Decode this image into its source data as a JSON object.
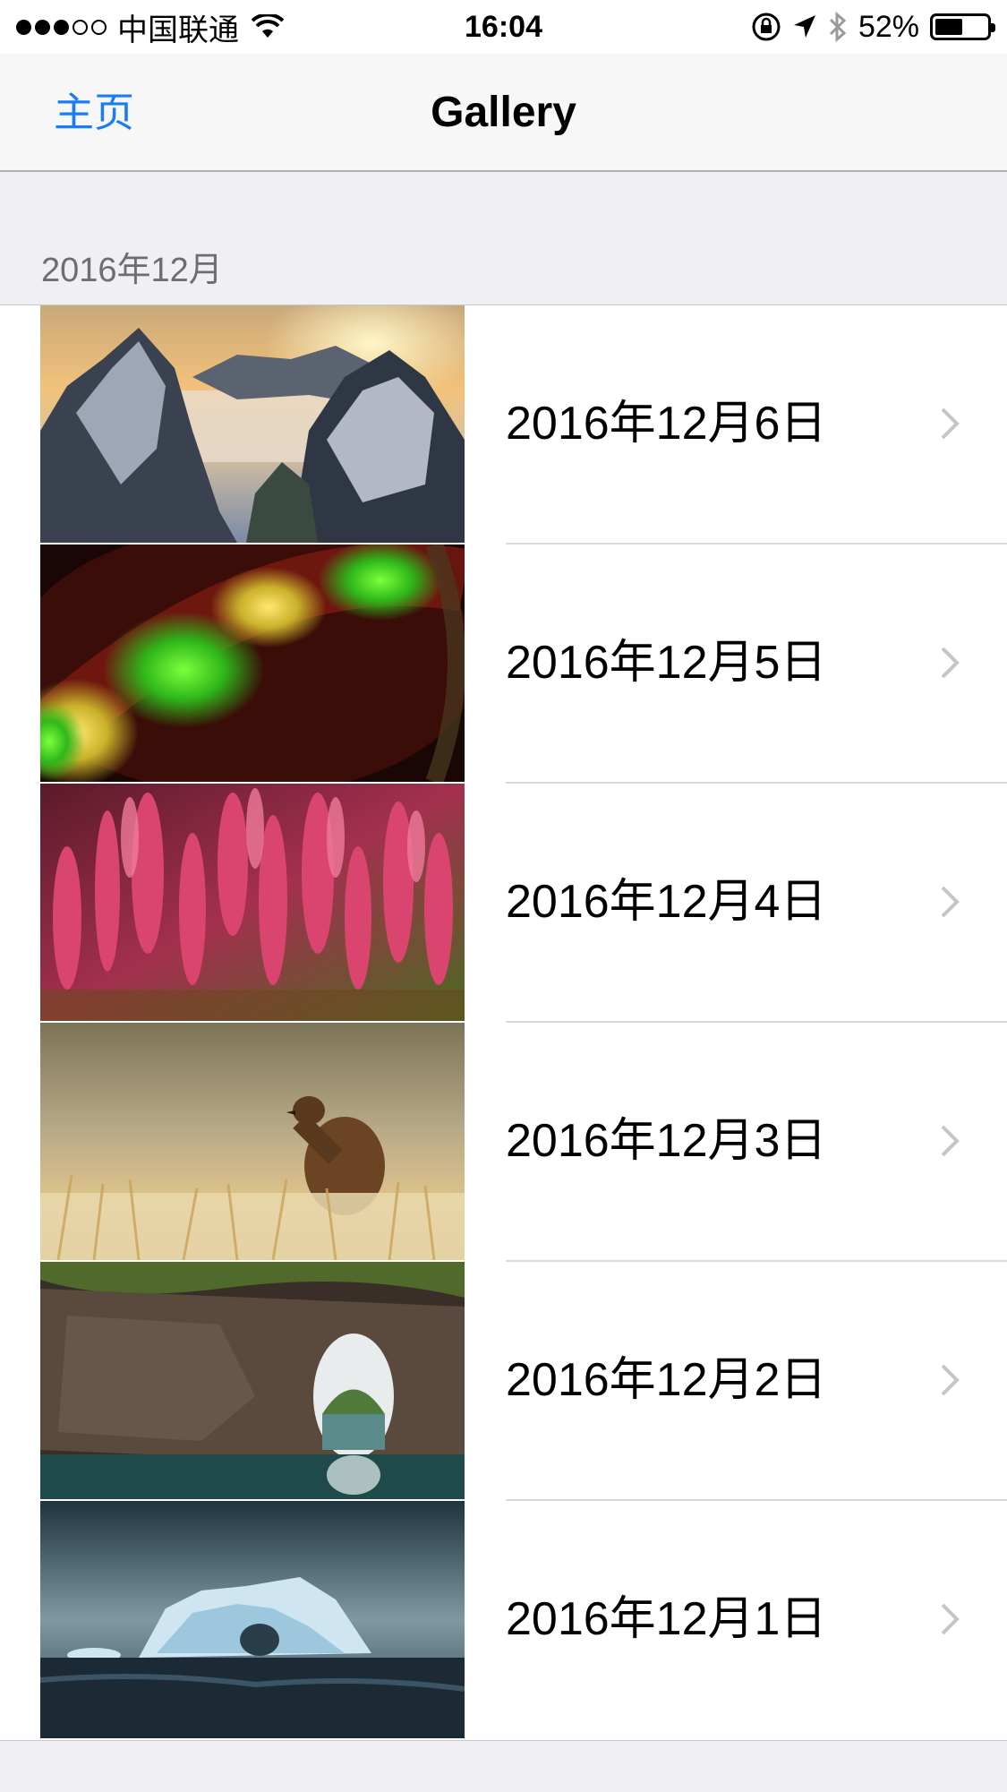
{
  "status_bar": {
    "carrier": "中国联通",
    "time": "16:04",
    "battery_percent": "52%",
    "battery_level": 0.52,
    "signal_bars_filled": 3,
    "signal_bars_total": 5
  },
  "nav": {
    "back_label": "主页",
    "title": "Gallery"
  },
  "section": {
    "header": "2016年12月"
  },
  "rows": [
    {
      "label": "2016年12月6日",
      "image": "snowy-mountain-peaks-photo"
    },
    {
      "label": "2016年12月5日",
      "image": "green-yellow-light-bokeh-photo"
    },
    {
      "label": "2016年12月4日",
      "image": "pink-flower-field-photo"
    },
    {
      "label": "2016年12月3日",
      "image": "grouse-bird-in-grass-photo"
    },
    {
      "label": "2016年12月2日",
      "image": "sea-rock-arch-photo"
    },
    {
      "label": "2016年12月1日",
      "image": "iceberg-at-sea-photo"
    }
  ],
  "colors": {
    "accent": "#1a7cf5",
    "background": "#efeff4",
    "section_text": "#6d6d72"
  }
}
